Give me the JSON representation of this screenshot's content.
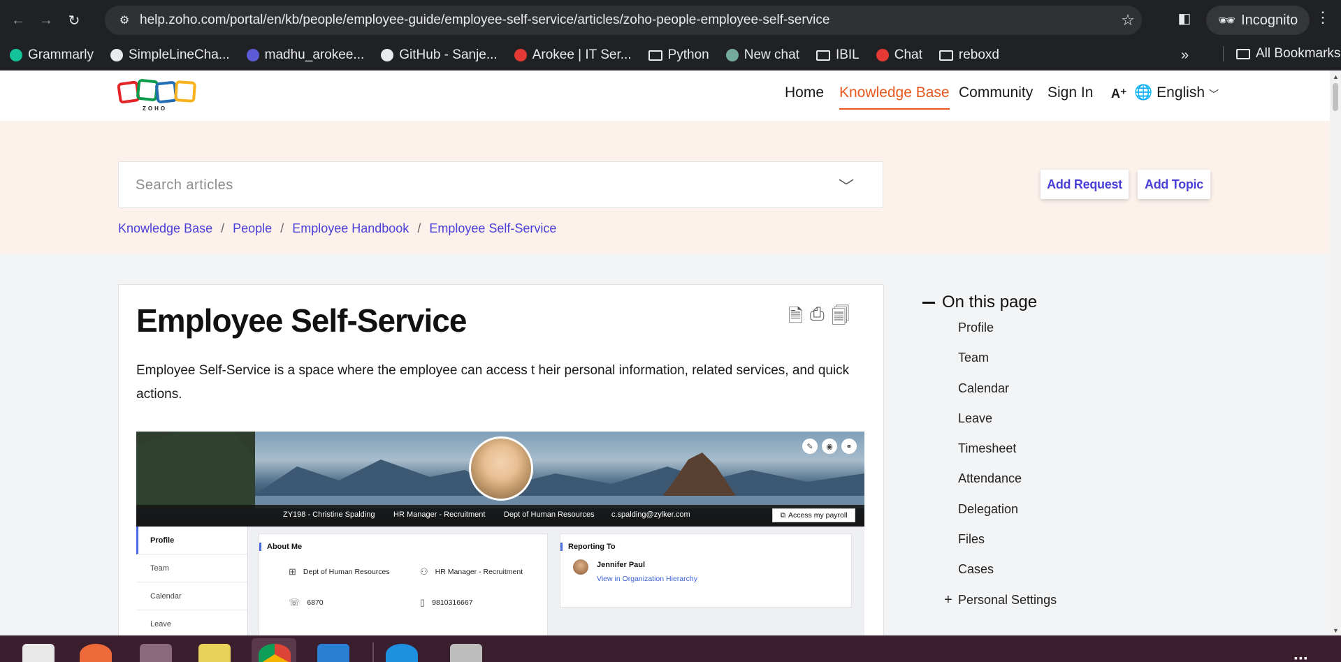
{
  "browser": {
    "url": "help.zoho.com/portal/en/kb/people/employee-guide/employee-self-service/articles/zoho-people-employee-self-service",
    "incognito_label": "Incognito",
    "all_bookmarks_label": "All Bookmarks",
    "more_label": "»"
  },
  "bookmarks": [
    {
      "label": "Grammarly",
      "color": "#15c39a"
    },
    {
      "label": "SimpleLineCha...",
      "color": "#e8eaed"
    },
    {
      "label": "madhu_arokee...",
      "color": "#5b5bd6"
    },
    {
      "label": "GitHub - Sanje...",
      "color": "#e8eaed"
    },
    {
      "label": "Arokee | IT Ser...",
      "color": "#e53935"
    },
    {
      "label": "Python",
      "folder": true
    },
    {
      "label": "New chat",
      "color": "#74aa9c"
    },
    {
      "label": "IBIL",
      "folder": true
    },
    {
      "label": "Chat",
      "color": "#e53935"
    },
    {
      "label": "reboxd",
      "folder": true
    }
  ],
  "site": {
    "logo_text": "ZOHO",
    "nav": {
      "home": "Home",
      "knowledge_base": "Knowledge Base",
      "community": "Community",
      "sign_in": "Sign In",
      "font_size": "A⁺",
      "language": "English"
    },
    "search_placeholder": "Search articles",
    "add_request": "Add Request",
    "add_topic": "Add Topic",
    "breadcrumb": [
      "Knowledge Base",
      "People",
      "Employee Handbook",
      "Employee Self-Service"
    ]
  },
  "article": {
    "title": "Employee Self-Service",
    "intro": "Employee Self-Service is a space  where the employee can access  t heir personal information, related services,  and quick actions.",
    "screenshot": {
      "banner": {
        "id_name": "ZY198 - Christine Spalding",
        "role": "HR Manager - Recruitment",
        "dept": "Dept of Human Resources",
        "email": "c.spalding@zylker.com",
        "payroll": "Access my payroll"
      },
      "sidebar": [
        "Profile",
        "Team",
        "Calendar",
        "Leave"
      ],
      "about": {
        "title": "About Me",
        "dept": "Dept of Human Resources",
        "role": "HR Manager - Recruitment",
        "ext": "6870",
        "mobile": "9810316667"
      },
      "reporting": {
        "title": "Reporting To",
        "name": "Jennifer Paul",
        "link": "View in Organization Hierarchy"
      }
    }
  },
  "toc": {
    "title": "On this page",
    "items": [
      "Profile",
      "Team",
      "Calendar",
      "Leave",
      "Timesheet",
      "Attendance",
      "Delegation",
      "Files",
      "Cases"
    ],
    "expandable": "Personal Settings"
  },
  "colors": {
    "accent_orange": "#e8581c",
    "link_purple": "#4a3fd6",
    "hero_bg": "#fdf1ec"
  }
}
